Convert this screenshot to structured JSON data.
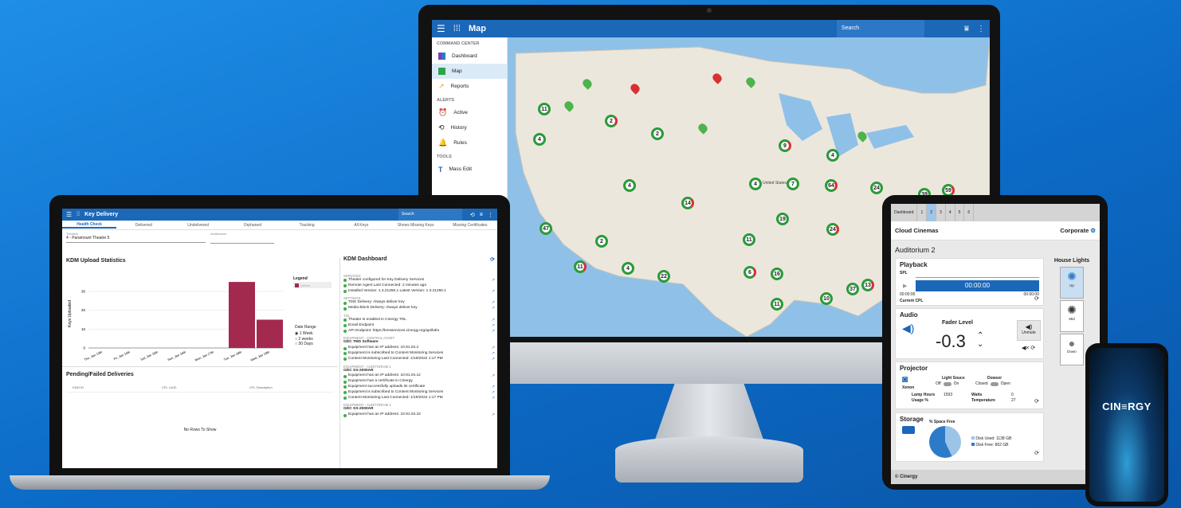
{
  "monitor": {
    "title": "Map",
    "search_placeholder": "Search",
    "sidebar": {
      "section1": "COMMAND CENTER",
      "dashboard": "Dashboard",
      "map": "Map",
      "reports": "Reports",
      "section2": "ALERTS",
      "active": "Active",
      "history": "History",
      "rules": "Rules",
      "section3": "TOOLS",
      "mass_edit": "Mass Edit"
    },
    "map_label": "United States",
    "pins": [
      "11",
      "2",
      "2",
      "4",
      "9",
      "4",
      "4",
      "14",
      "4",
      "7",
      "64",
      "24",
      "39",
      "59",
      "19",
      "11",
      "24",
      "2",
      "47",
      "11",
      "4",
      "22",
      "6",
      "16",
      "37",
      "13",
      "11",
      "10"
    ]
  },
  "laptop": {
    "title": "Key Delivery",
    "search_placeholder": "Search",
    "tabs": [
      "Health Check",
      "Delivered",
      "Undelivered",
      "Orphaned",
      "Tracking",
      "All Keys",
      "Shows Missing Keys",
      "Missing Certificates"
    ],
    "theaters_label": "Theaters",
    "theater_value": "4 - Paramount Theatre 5",
    "auditorium_label": "Auditoriums",
    "upload_title": "KDM Upload Statistics",
    "ylabel": "Keys Uploaded",
    "legend_title": "Legend",
    "legend_item": "Deliver",
    "date_range": "Date Range",
    "ranges": [
      "1 Week",
      "2 weeks",
      "30 Days"
    ],
    "pending_title": "Pending/Failed Deliveries",
    "cols": [
      "KDM ID",
      "CPL UUID",
      "CPL Description"
    ],
    "no_rows": "No Rows To Show",
    "dash_title": "KDM Dashboard",
    "services": "SERVICES",
    "s1": "Theater configured for Key Delivery Services",
    "s2": "Remote Agent Last Connected: 2 minutes ago",
    "s3": "Installed Version: 1.3.21250.1 Latest Version: 1.3.21250.1",
    "settings": "SETTINGS",
    "st1": "TMS Delivery: Always deliver key",
    "st2": "Media Block Delivery: Always deliver key",
    "tdl": "TDL",
    "t1": "Theater is enabled in Cinergy TDL",
    "t2": "Email Endpoint",
    "t3": "API Endpoint: https://kmsservices.cinergy.org/api/kdm",
    "eq1": "EQUIPMENT - CENTRAL ASSET",
    "gdc1": "GDC TMS Software",
    "e1a": "Equipment has an IP address: 10.91.04.2",
    "e1b": "Equipment is subscribed to Content Monitoring Services",
    "e1c": "Content Monitoring Last Connected: 1/19/2022 1:17 PM",
    "eq2": "EQUIPMENT - AUDITORIUM 1",
    "gdc2": "GDC SX-2000AR",
    "e2a": "Equipment has an IP address: 10.91.04.12",
    "e2b": "Equipment has a certificate in Cinergy",
    "e2c": "Equipment successfully uploads its certificate",
    "e2d": "Equipment is subscribed to Content Monitoring Services",
    "e2e": "Content Monitoring Last Connected: 1/19/2022 1:17 PM",
    "eq3": "EQUIPMENT - AUDITORIUM 2",
    "gdc3": "GDC SX-2000AR",
    "e3a": "Equipment has an IP address: 10.91.04.22"
  },
  "chart_data": {
    "type": "bar",
    "categories": [
      "Thu, Jan 13th",
      "Fri, Jan 14th",
      "Sat, Jan 15th",
      "Sun, Jan 16th",
      "Mon, Jan 17th",
      "Tue, Jan 18th",
      "Wed, Jan 19th"
    ],
    "values": [
      0,
      0,
      0,
      0,
      0,
      35,
      15
    ],
    "ylabel": "Keys Uploaded",
    "ylim": [
      0,
      38
    ],
    "yticks": [
      0,
      10,
      20,
      30
    ],
    "color": "#a3294f"
  },
  "tablet": {
    "tabs": [
      "Dashboard",
      "1",
      "2",
      "3",
      "4",
      "5",
      "6"
    ],
    "org": "Cloud Cinemas",
    "corp": "Corporate",
    "auditorium": "Auditorium 2",
    "playback": "Playback",
    "spl": "SPL",
    "time": "00:00:00",
    "time_left": "00:00:00",
    "time_right": "00:00:00",
    "current_cpl": "Current CPL",
    "audio": "Audio",
    "fader": "Fader Level",
    "fader_value": "-0.3",
    "unmute": "Unmute",
    "projector": "Projector",
    "xenon": "Xenon",
    "light_source": "Light Souce",
    "off": "Off",
    "on": "On",
    "douser": "Dowser",
    "closed": "Closed",
    "open": "Open",
    "lamp_hours": "Lamp Hours",
    "lamp_val": "1593",
    "watts": "Watts",
    "watts_val": "0",
    "usage": "Usage %",
    "temp": "Temperature",
    "temp_val": "27",
    "storage": "Storage",
    "space_free": "% Space Free",
    "disk_used": "Disk Used: 1138 GB",
    "disk_free": "Disk Free: 862 GB",
    "house_lights": "House Lights",
    "up": "Up",
    "mid": "Mid",
    "down": "Down",
    "footer": "© Cinergy"
  },
  "phone": {
    "brand": "CIN≡RGY"
  }
}
